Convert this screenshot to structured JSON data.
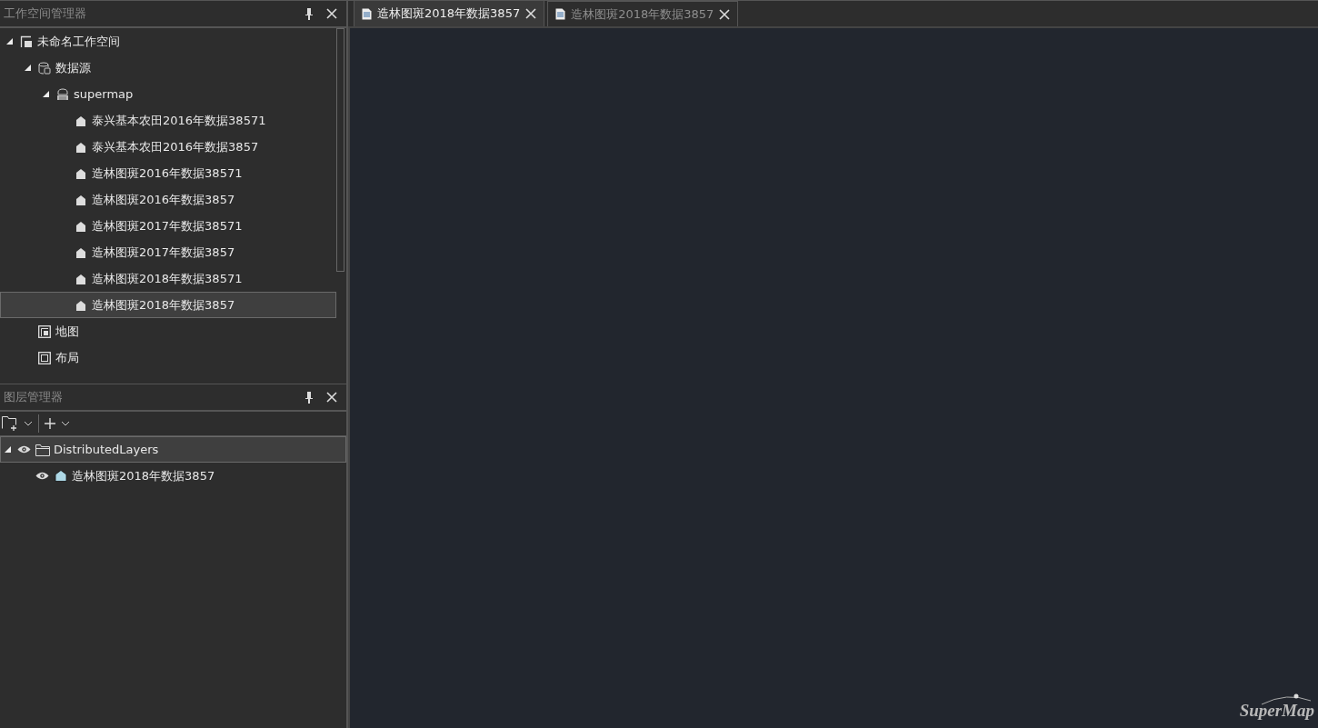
{
  "workspace_panel": {
    "title": "工作空间管理器",
    "tree": [
      {
        "kind": "workspace",
        "label": "未命名工作空间",
        "expanded": true,
        "selected": false,
        "children": [
          {
            "kind": "datasources",
            "label": "数据源",
            "expanded": true,
            "selected": false,
            "children": [
              {
                "kind": "datasource",
                "label": "supermap",
                "expanded": true,
                "selected": false,
                "children": [
                  {
                    "kind": "region",
                    "label": "泰兴基本农田2016年数据38571",
                    "selected": false
                  },
                  {
                    "kind": "region",
                    "label": "泰兴基本农田2016年数据3857",
                    "selected": false
                  },
                  {
                    "kind": "region",
                    "label": "造林图斑2016年数据38571",
                    "selected": false
                  },
                  {
                    "kind": "region",
                    "label": "造林图斑2016年数据3857",
                    "selected": false
                  },
                  {
                    "kind": "region",
                    "label": "造林图斑2017年数据38571",
                    "selected": false
                  },
                  {
                    "kind": "region",
                    "label": "造林图斑2017年数据3857",
                    "selected": false
                  },
                  {
                    "kind": "region",
                    "label": "造林图斑2018年数据38571",
                    "selected": false
                  },
                  {
                    "kind": "region",
                    "label": "造林图斑2018年数据3857",
                    "selected": true
                  }
                ]
              }
            ]
          },
          {
            "kind": "maps",
            "label": "地图",
            "selected": false
          },
          {
            "kind": "layouts",
            "label": "布局",
            "selected": false
          }
        ]
      }
    ]
  },
  "layer_panel": {
    "title": "图层管理器",
    "tree": [
      {
        "kind": "group",
        "label": "DistributedLayers",
        "expanded": true,
        "visible": true,
        "selected": true,
        "children": [
          {
            "kind": "region",
            "label": "造林图斑2018年数据3857",
            "visible": true,
            "selected": false
          }
        ]
      }
    ]
  },
  "tabs": [
    {
      "label": "造林图斑2018年数据3857",
      "selected": true
    },
    {
      "label": "造林图斑2018年数据3857",
      "selected": false
    }
  ],
  "map": {
    "logo": "SuperMap"
  }
}
